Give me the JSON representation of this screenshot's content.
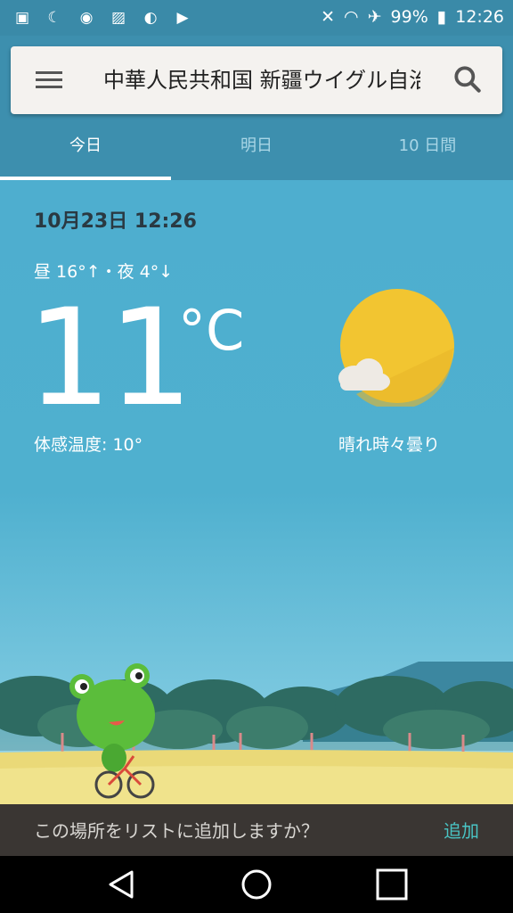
{
  "status_bar": {
    "battery": "99%",
    "time": "12:26",
    "left_icons": [
      "contacts-icon",
      "moon-icon",
      "lock-icon",
      "image-icon",
      "toggle-icon",
      "play-store-icon"
    ],
    "right_icons": [
      "mute-icon",
      "wifi-icon",
      "airplane-icon",
      "battery-icon"
    ]
  },
  "search": {
    "location": "中華人民共和国 新疆ウイグル自治区"
  },
  "tabs": [
    {
      "label": "今日",
      "active": true
    },
    {
      "label": "明日",
      "active": false
    },
    {
      "label": "10 日間",
      "active": false
    }
  ],
  "weather": {
    "datetime": "10月23日 12:26",
    "high_low": "昼 16°↑・夜 4°↓",
    "temperature": "11",
    "unit": "°C",
    "feels_like": "体感温度: 10°",
    "condition": "晴れ時々曇り"
  },
  "snackbar": {
    "message": "この場所をリストに追加しますか？",
    "action": "追加"
  },
  "colors": {
    "accent": "#49c4c4",
    "sky": "#4eaecf",
    "sun": "#f2c531"
  }
}
